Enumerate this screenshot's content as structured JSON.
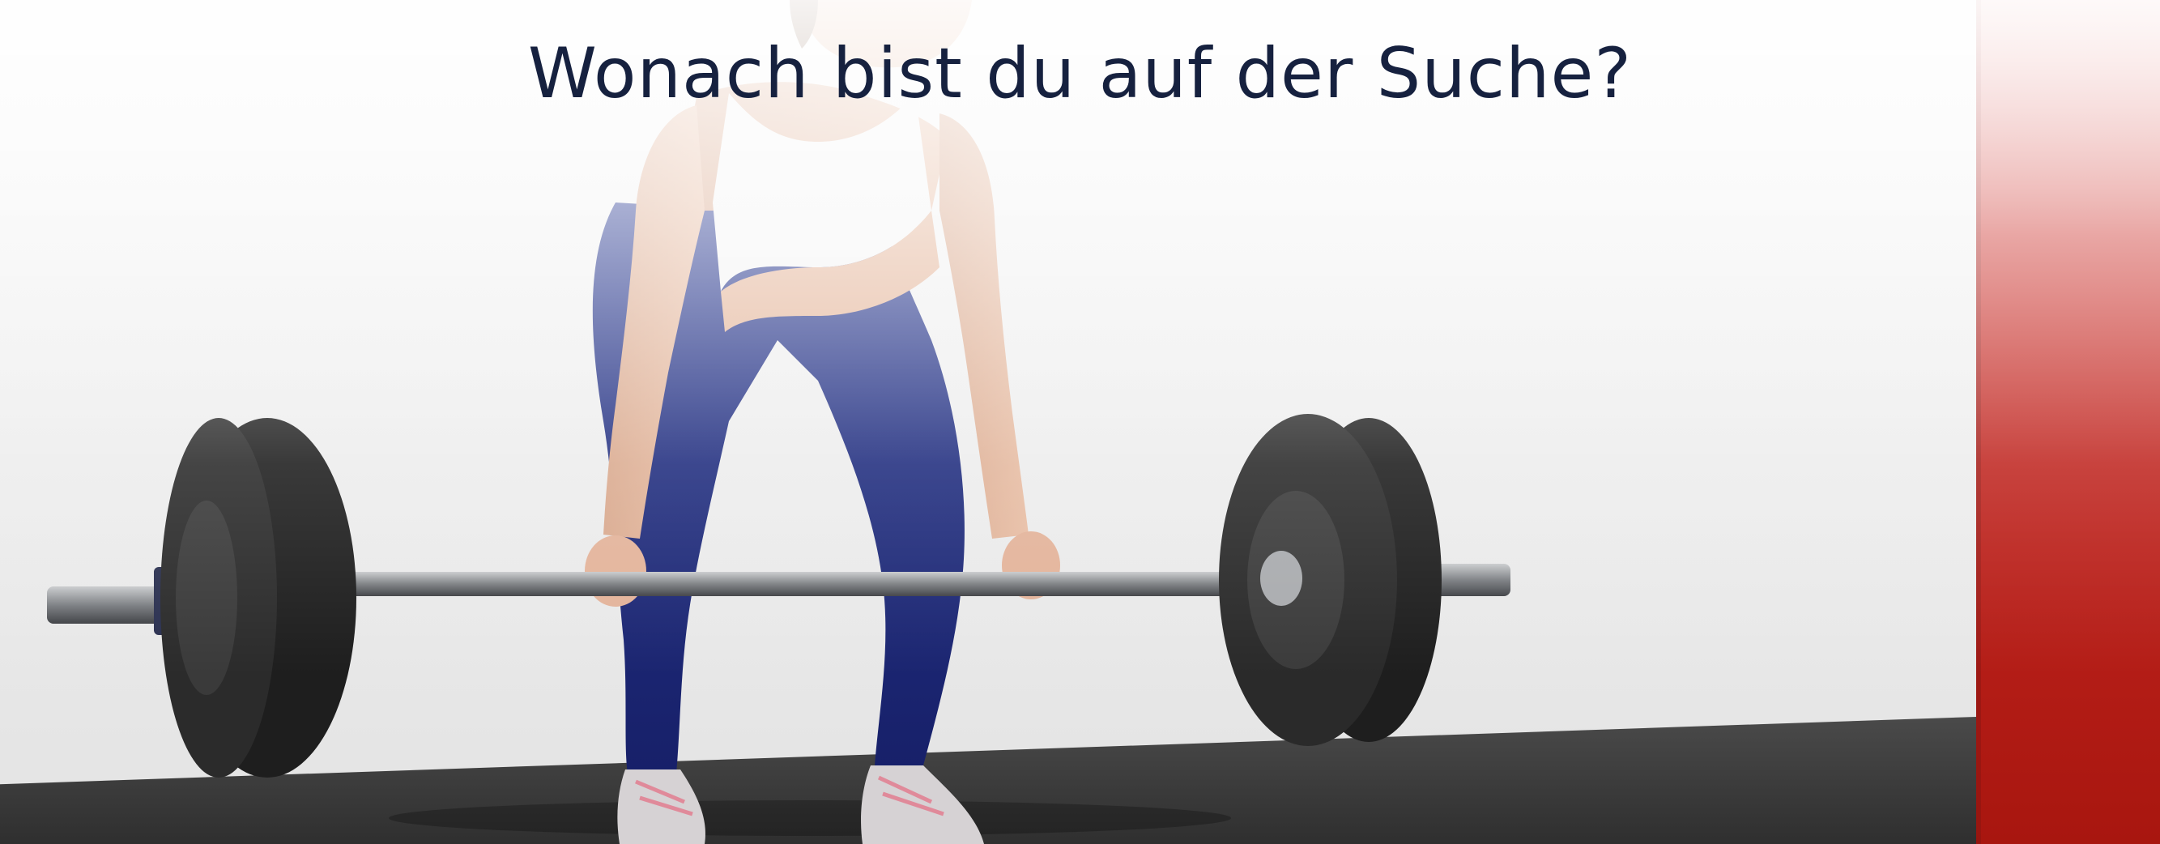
{
  "hero": {
    "title": "Wonach bist du auf der Suche?",
    "image_subject": "woman performing a barbell deadlift in a gym"
  },
  "colors": {
    "title": "#16213f",
    "wall": "#ececec",
    "floor": "#343434",
    "accent_wall": "#bb211b",
    "leggings": "#1e2a7e",
    "plates": "#1f1f1f"
  }
}
